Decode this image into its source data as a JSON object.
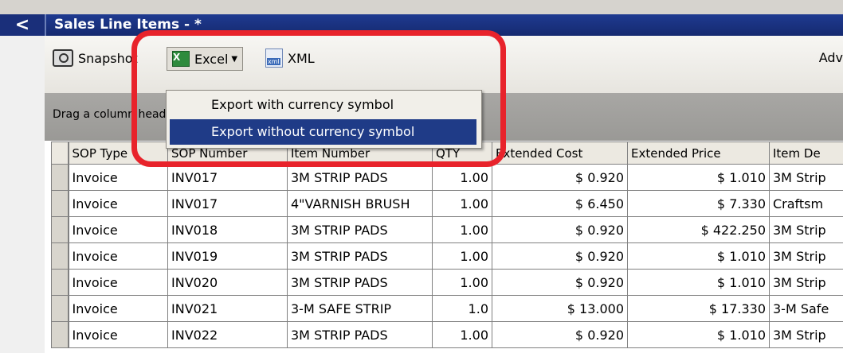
{
  "window": {
    "back_glyph": "<",
    "title": "Sales Line Items - *"
  },
  "toolbar": {
    "snapshot_label": "Snapshot",
    "excel_label": "Excel",
    "xml_label": "XML",
    "adv_label": "Adv"
  },
  "groupbar": {
    "hint": "Drag a column header here"
  },
  "excel_menu": {
    "items": [
      {
        "label": "Export with currency symbol",
        "selected": false
      },
      {
        "label": "Export without currency symbol",
        "selected": true
      }
    ]
  },
  "grid": {
    "columns": [
      "SOP Type",
      "SOP Number",
      "Item Number",
      "QTY",
      "Extended Cost",
      "Extended Price",
      "Item De"
    ],
    "rows": [
      [
        "Invoice",
        "INV017",
        "3M STRIP PADS",
        "1.00",
        "$ 0.920",
        "$ 1.010",
        "3M Strip"
      ],
      [
        "Invoice",
        "INV017",
        "4\"VARNISH BRUSH",
        "1.00",
        "$ 6.450",
        "$ 7.330",
        "Craftsm"
      ],
      [
        "Invoice",
        "INV018",
        "3M STRIP PADS",
        "1.00",
        "$ 0.920",
        "$ 422.250",
        "3M Strip"
      ],
      [
        "Invoice",
        "INV019",
        "3M STRIP PADS",
        "1.00",
        "$ 0.920",
        "$ 1.010",
        "3M Strip"
      ],
      [
        "Invoice",
        "INV020",
        "3M STRIP PADS",
        "1.00",
        "$ 0.920",
        "$ 1.010",
        "3M Strip"
      ],
      [
        "Invoice",
        "INV021",
        "3-M SAFE STRIP",
        "1.0",
        "$ 13.000",
        "$ 17.330",
        "3-M Safe"
      ],
      [
        "Invoice",
        "INV022",
        "3M STRIP PADS",
        "1.00",
        "$ 0.920",
        "$ 1.010",
        "3M Strip"
      ]
    ]
  },
  "colors": {
    "title_bar": "#1f3a90",
    "menu_highlight": "#1f3b87",
    "annotation_red": "#e8232b"
  }
}
